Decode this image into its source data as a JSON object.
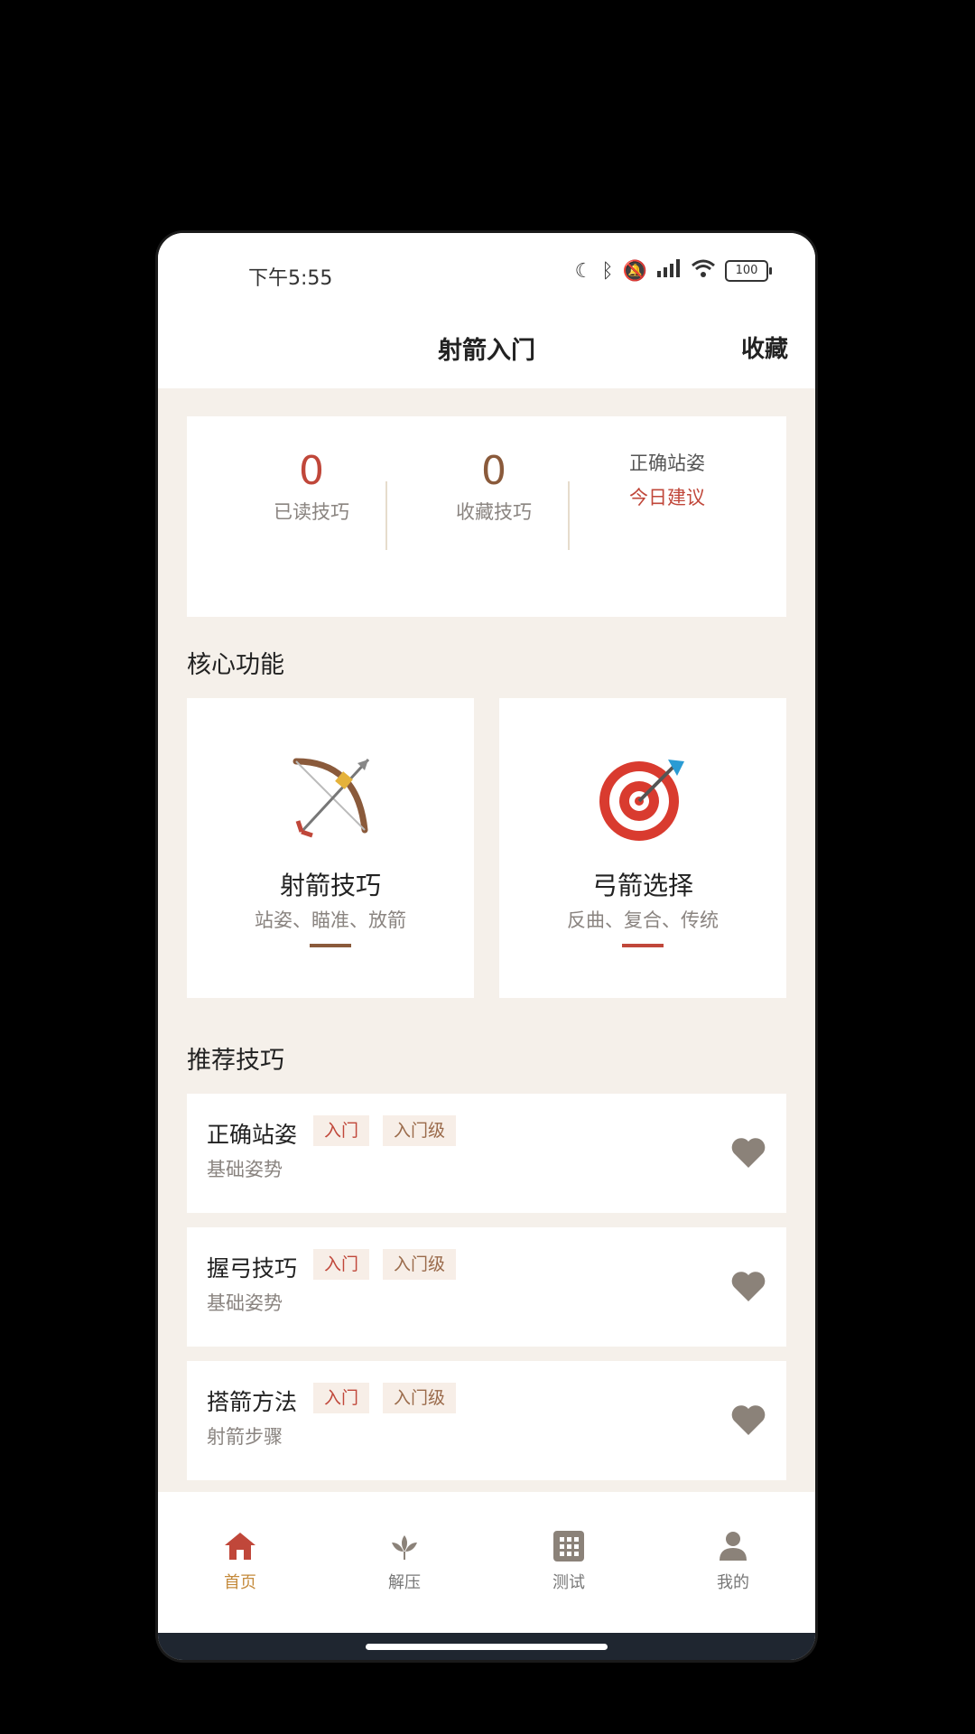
{
  "status_bar": {
    "time": "下午5:55",
    "battery": "100"
  },
  "header": {
    "title": "射箭入门",
    "favorites": "收藏"
  },
  "stats": {
    "read": {
      "value": "0",
      "label": "已读技巧"
    },
    "favorites": {
      "value": "0",
      "label": "收藏技巧"
    },
    "tip_of_day": {
      "title": "正确站姿",
      "label": "今日建议"
    }
  },
  "core": {
    "title": "核心功能",
    "items": [
      {
        "title": "射箭技巧",
        "desc": "站姿、瞄准、放箭",
        "icon": "bow-and-arrow-icon",
        "accent": "#8a5a3b"
      },
      {
        "title": "弓箭选择",
        "desc": "反曲、复合、传统",
        "icon": "target-icon",
        "accent": "#c0473a"
      }
    ]
  },
  "recommended": {
    "title": "推荐技巧",
    "items": [
      {
        "name": "正确站姿",
        "tag1": "入门",
        "tag2": "入门级",
        "category": "基础姿势"
      },
      {
        "name": "握弓技巧",
        "tag1": "入门",
        "tag2": "入门级",
        "category": "基础姿势"
      },
      {
        "name": "搭箭方法",
        "tag1": "入门",
        "tag2": "入门级",
        "category": "射箭步骤"
      }
    ]
  },
  "tabs": [
    {
      "label": "首页",
      "icon": "home-icon",
      "active": true
    },
    {
      "label": "解压",
      "icon": "lotus-icon",
      "active": false
    },
    {
      "label": "测试",
      "icon": "grid-icon",
      "active": false
    },
    {
      "label": "我的",
      "icon": "person-icon",
      "active": false
    }
  ],
  "colors": {
    "accent_red": "#c0473a",
    "accent_brown": "#8a5a3b",
    "tab_active": "#c48a3b",
    "background": "#f5f0ea"
  }
}
